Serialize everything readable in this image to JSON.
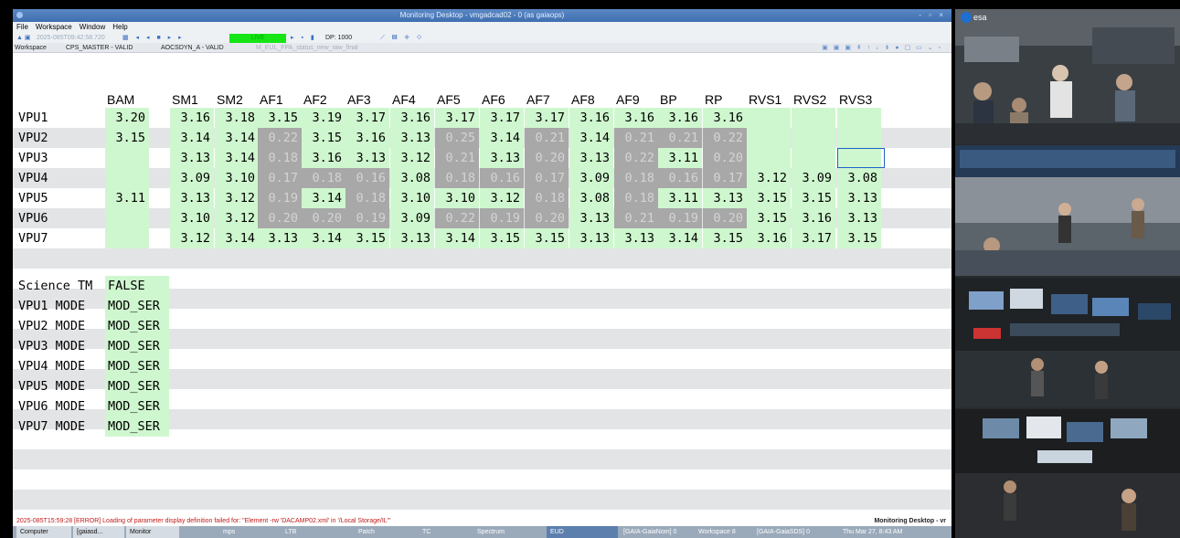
{
  "window": {
    "title": "Monitoring Desktop - vmgadcad02 - 0 (as gaiaops)",
    "controls": "- ▫ ×"
  },
  "menu": [
    "File",
    "Workspace",
    "Window",
    "Help"
  ],
  "toolbar": {
    "timestamp": "2025-085T09:42:58.720",
    "live": "LIVE",
    "dp": "DP: 1000"
  },
  "tabs": [
    "Workspace",
    "CPS_MASTER - VALID",
    "AOCSDYN_A - VALID",
    "M_EUL_FPA_status_new_raw_final"
  ],
  "grid": {
    "columns": [
      "BAM",
      "SM1",
      "SM2",
      "AF1",
      "AF2",
      "AF3",
      "AF4",
      "AF5",
      "AF6",
      "AF7",
      "AF8",
      "AF9",
      "BP",
      "RP",
      "RVS1",
      "RVS2",
      "RVS3"
    ],
    "rows": [
      {
        "label": "VPU1",
        "cells": [
          "3.20",
          "3.16",
          "3.18",
          "3.15",
          "3.19",
          "3.17",
          "3.16",
          "3.17",
          "3.17",
          "3.17",
          "3.16",
          "3.16",
          "3.16",
          "3.16",
          "",
          "",
          ""
        ]
      },
      {
        "label": "VPU2",
        "cells": [
          "3.15",
          "3.14",
          "3.14",
          "0.22",
          "3.15",
          "3.16",
          "3.13",
          "0.25",
          "3.14",
          "0.21",
          "3.14",
          "0.21",
          "0.21",
          "0.22",
          "",
          "",
          ""
        ]
      },
      {
        "label": "VPU3",
        "cells": [
          "",
          "3.13",
          "3.14",
          "0.18",
          "3.16",
          "3.13",
          "3.12",
          "0.21",
          "3.13",
          "0.20",
          "3.13",
          "0.22",
          "3.11",
          "0.20",
          "",
          "",
          ""
        ]
      },
      {
        "label": "VPU4",
        "cells": [
          "",
          "3.09",
          "3.10",
          "0.17",
          "0.18",
          "0.16",
          "3.08",
          "0.18",
          "0.16",
          "0.17",
          "3.09",
          "0.18",
          "0.16",
          "0.17",
          "3.12",
          "3.09",
          "3.08"
        ]
      },
      {
        "label": "VPU5",
        "cells": [
          "3.11",
          "3.13",
          "3.12",
          "0.19",
          "3.14",
          "0.18",
          "3.10",
          "3.10",
          "3.12",
          "0.18",
          "3.08",
          "0.18",
          "3.11",
          "3.13",
          "3.15",
          "3.15",
          "3.13"
        ]
      },
      {
        "label": "VPU6",
        "cells": [
          "",
          "3.10",
          "3.12",
          "0.20",
          "0.20",
          "0.19",
          "3.09",
          "0.22",
          "0.19",
          "0.20",
          "3.13",
          "0.21",
          "0.19",
          "0.20",
          "3.15",
          "3.16",
          "3.13"
        ]
      },
      {
        "label": "VPU7",
        "cells": [
          "",
          "3.12",
          "3.14",
          "3.13",
          "3.14",
          "3.15",
          "3.13",
          "3.14",
          "3.15",
          "3.15",
          "3.13",
          "3.13",
          "3.14",
          "3.15",
          "3.16",
          "3.17",
          "3.15"
        ]
      }
    ]
  },
  "science_tm": {
    "label": "Science TM",
    "value": "FALSE"
  },
  "modes": [
    {
      "label": "VPU1 MODE",
      "value": "MOD_SER"
    },
    {
      "label": "VPU2 MODE",
      "value": "MOD_SER"
    },
    {
      "label": "VPU3 MODE",
      "value": "MOD_SER"
    },
    {
      "label": "VPU4 MODE",
      "value": "MOD_SER"
    },
    {
      "label": "VPU5 MODE",
      "value": "MOD_SER"
    },
    {
      "label": "VPU6 MODE",
      "value": "MOD_SER"
    },
    {
      "label": "VPU7 MODE",
      "value": "MOD_SER"
    }
  ],
  "status": {
    "error": "2025-085T15:59:28 [ERROR] Loading of parameter display definition failed for: \"Element -rw 'DACAMP02.xml' in '/Local Storage/IL'\"",
    "app_name": "Monitoring Desktop - vr"
  },
  "taskbar": [
    "Computer",
    "[gaiasd...",
    "Monitor",
    "mps",
    "LTB",
    "Patch",
    "TC",
    "Spectrum",
    "EUD",
    "[GAIA-GaiaNom] 0",
    "Workspace 8",
    "[GAIA-GaiaSDS] 0",
    "Thu Mar 27,  8:43 AM"
  ],
  "colors": {
    "ok": "#cff7cf",
    "off": "#a8a8a8",
    "live": "#16e516",
    "error": "#c01a1a",
    "selection": "#1b62c9"
  },
  "video": {
    "logo": "esa"
  }
}
